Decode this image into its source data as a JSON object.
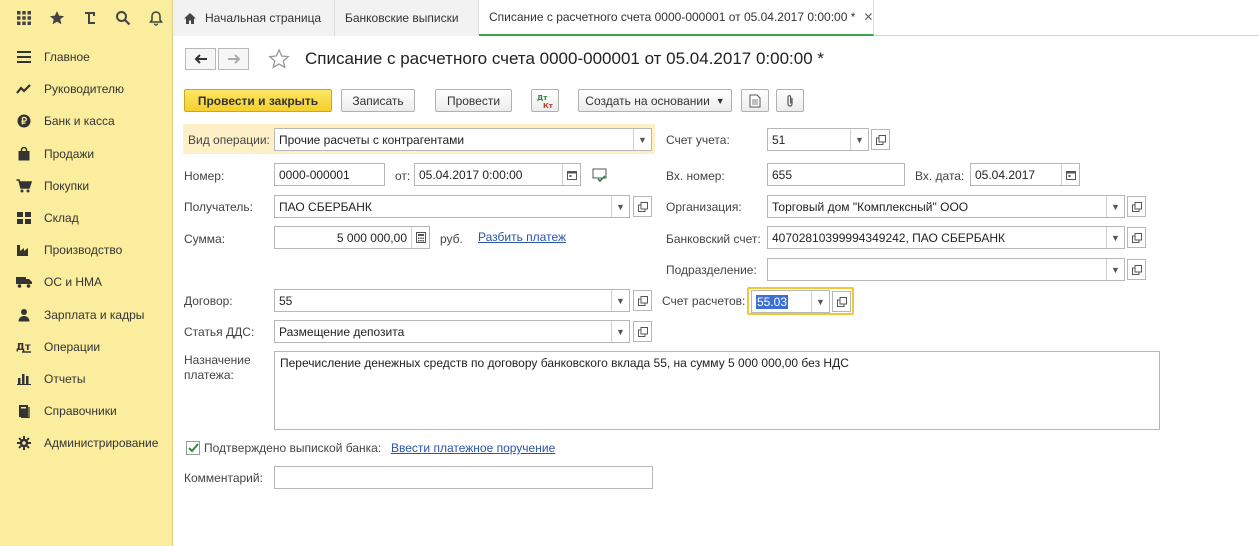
{
  "tabs": [
    {
      "label": "Начальная страница"
    },
    {
      "label": "Банковские выписки"
    },
    {
      "label": "Списание с расчетного счета 0000-000001 от 05.04.2017 0:00:00 *"
    }
  ],
  "sidebar": {
    "items": [
      {
        "label": "Главное"
      },
      {
        "label": "Руководителю"
      },
      {
        "label": "Банк и касса"
      },
      {
        "label": "Продажи"
      },
      {
        "label": "Покупки"
      },
      {
        "label": "Склад"
      },
      {
        "label": "Производство"
      },
      {
        "label": "ОС и НМА"
      },
      {
        "label": "Зарплата и кадры"
      },
      {
        "label": "Операции"
      },
      {
        "label": "Отчеты"
      },
      {
        "label": "Справочники"
      },
      {
        "label": "Администрирование"
      }
    ]
  },
  "doc": {
    "title": "Списание с расчетного счета 0000-000001 от 05.04.2017 0:00:00 *"
  },
  "toolbar": {
    "post_close": "Провести и закрыть",
    "save": "Записать",
    "post": "Провести",
    "create_based": "Создать на основании"
  },
  "form": {
    "op_type": {
      "label": "Вид операции:",
      "value": "Прочие расчеты с контрагентами"
    },
    "account": {
      "label": "Счет учета:",
      "value": "51"
    },
    "number": {
      "label": "Номер:",
      "value": "0000-000001"
    },
    "date": {
      "label": "от:",
      "value": "05.04.2017  0:00:00"
    },
    "in_number": {
      "label": "Вх. номер:",
      "value": "655"
    },
    "in_date": {
      "label": "Вх. дата:",
      "value": "05.04.2017"
    },
    "recipient": {
      "label": "Получатель:",
      "value": "ПАО СБЕРБАНК"
    },
    "organization": {
      "label": "Организация:",
      "value": "Торговый дом \"Комплексный\" ООО"
    },
    "sum": {
      "label": "Сумма:",
      "value": "5 000 000,00",
      "currency": "руб."
    },
    "split_link": "Разбить платеж",
    "bank_account": {
      "label": "Банковский счет:",
      "value": "40702810399994349242, ПАО СБЕРБАНК"
    },
    "department": {
      "label": "Подразделение:",
      "value": ""
    },
    "contract": {
      "label": "Договор:",
      "value": "55"
    },
    "settlement_account": {
      "label": "Счет расчетов:",
      "value": "55.03"
    },
    "dds": {
      "label": "Статья ДДС:",
      "value": "Размещение депозита"
    },
    "purpose": {
      "label_1": "Назначение",
      "label_2": "платежа:",
      "value": "Перечисление денежных средств по договору банковского вклада 55, на сумму 5 000 000,00 без НДС"
    },
    "confirmed": {
      "label": "Подтверждено выпиской банка:",
      "checked": true
    },
    "payment_order_link": "Ввести платежное поручение",
    "comment": {
      "label": "Комментарий:",
      "value": ""
    }
  },
  "colors": {
    "sidebar_bg": "#fbed9e",
    "primary_button": "#f5cf2b",
    "highlight_field": "#f3c634",
    "link": "#2855a8",
    "active_tab_underline": "#3aa64a"
  }
}
